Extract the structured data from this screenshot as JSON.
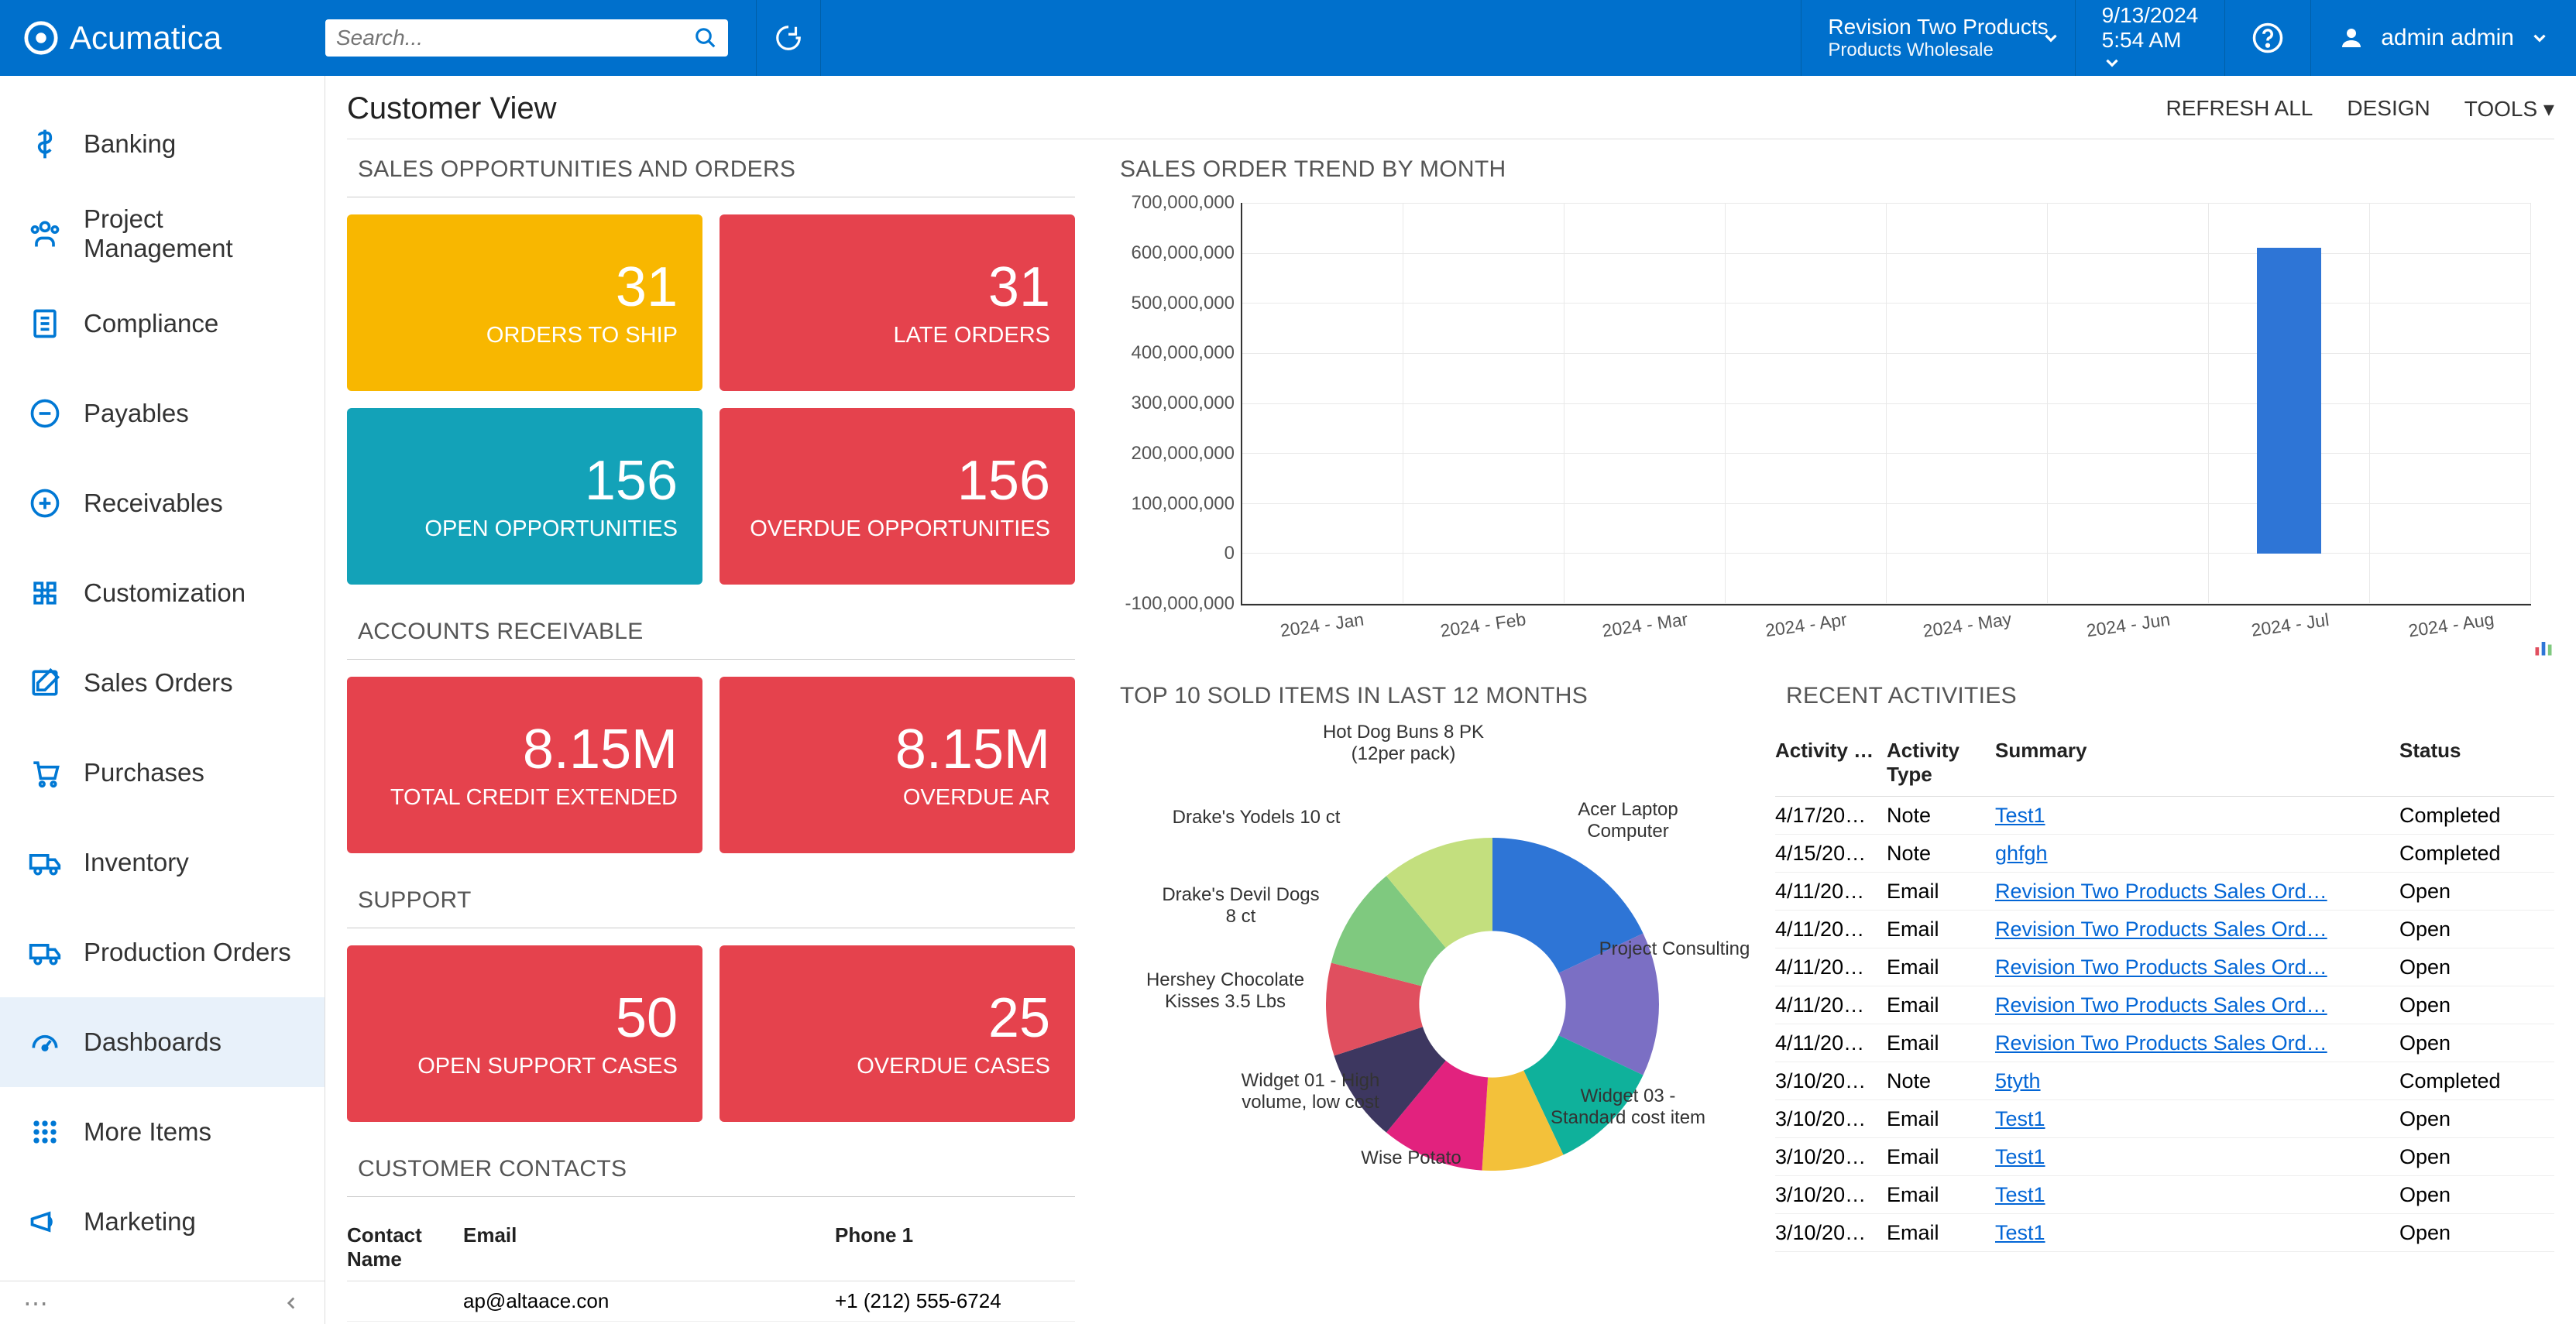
{
  "topbar": {
    "logo_text": "Acumatica",
    "search_placeholder": "Search...",
    "company_line1": "Revision Two Products",
    "company_line2": "Products Wholesale",
    "date_line1": "9/13/2024",
    "date_line2": "5:54 AM",
    "user": "admin admin"
  },
  "sidebar": {
    "items": [
      {
        "label": "Banking",
        "icon": "dollar"
      },
      {
        "label": "Project Management",
        "icon": "person"
      },
      {
        "label": "Compliance",
        "icon": "document"
      },
      {
        "label": "Payables",
        "icon": "minus-circle"
      },
      {
        "label": "Receivables",
        "icon": "plus-circle"
      },
      {
        "label": "Customization",
        "icon": "puzzle"
      },
      {
        "label": "Sales Orders",
        "icon": "edit"
      },
      {
        "label": "Purchases",
        "icon": "cart"
      },
      {
        "label": "Inventory",
        "icon": "truck"
      },
      {
        "label": "Production Orders",
        "icon": "truck"
      },
      {
        "label": "Dashboards",
        "icon": "gauge",
        "active": true
      },
      {
        "label": "More Items",
        "icon": "grid"
      },
      {
        "label": "Marketing",
        "icon": "megaphone"
      }
    ]
  },
  "page": {
    "title": "Customer View",
    "actions": {
      "refresh": "REFRESH ALL",
      "design": "DESIGN",
      "tools": "TOOLS"
    }
  },
  "sections": {
    "sales_opp": "SALES OPPORTUNITIES AND ORDERS",
    "trend": "SALES ORDER TREND BY MONTH",
    "ar": "ACCOUNTS RECEIVABLE",
    "support": "SUPPORT",
    "contacts": "CUSTOMER CONTACTS",
    "top10": "TOP 10 SOLD ITEMS IN LAST 12 MONTHS",
    "activities": "RECENT ACTIVITIES"
  },
  "kpi": {
    "orders_to_ship": {
      "val": "31",
      "lab": "ORDERS TO SHIP"
    },
    "late_orders": {
      "val": "31",
      "lab": "LATE ORDERS"
    },
    "open_opp": {
      "val": "156",
      "lab": "OPEN OPPORTUNITIES"
    },
    "overdue_opp": {
      "val": "156",
      "lab": "OVERDUE OPPORTUNITIES"
    },
    "credit_extended": {
      "val": "8.15M",
      "lab": "TOTAL CREDIT EXTENDED"
    },
    "overdue_ar": {
      "val": "8.15M",
      "lab": "OVERDUE AR"
    },
    "open_support": {
      "val": "50",
      "lab": "OPEN SUPPORT CASES"
    },
    "overdue_cases": {
      "val": "25",
      "lab": "OVERDUE CASES"
    }
  },
  "chart_data": {
    "type": "bar",
    "title": "SALES ORDER TREND BY MONTH",
    "xlabel": "",
    "ylabel": "",
    "ylim": [
      -100000000,
      700000000
    ],
    "y_ticks": [
      "700,000,000",
      "600,000,000",
      "500,000,000",
      "400,000,000",
      "300,000,000",
      "200,000,000",
      "100,000,000",
      "0",
      "-100,000,000"
    ],
    "categories": [
      "2024 - Jan",
      "2024 - Feb",
      "2024 - Mar",
      "2024 - Apr",
      "2024 - May",
      "2024 - Jun",
      "2024 - Jul",
      "2024 - Aug"
    ],
    "values": [
      0,
      0,
      0,
      0,
      0,
      0,
      610000000,
      0
    ]
  },
  "contacts": {
    "headers": {
      "name": "Contact Name",
      "email": "Email",
      "phone": "Phone 1"
    },
    "rows": [
      {
        "name": "",
        "email": "ap@altaace.con",
        "phone": "+1 (212) 555-6724"
      }
    ]
  },
  "pie": {
    "labels": [
      "Hot Dog Buns 8 PK (12per pack)",
      "Acer Laptop Computer",
      "Project Consulting",
      "Widget 03 - Standard cost item",
      "Wise Potato",
      "Widget 01 - High volume, low cost",
      "Hershey Chocolate Kisses 3.5 Lbs",
      "Drake's Devil Dogs 8 ct",
      "Drake's Yodels 10 ct"
    ],
    "slices": [
      {
        "label": "Acer Laptop Computer",
        "pct": 18,
        "color": "#2e75d6"
      },
      {
        "label": "Project Consulting",
        "pct": 14,
        "color": "#7b6fc4"
      },
      {
        "label": "Widget 03 - Standard cost item",
        "pct": 11,
        "color": "#0fb19b"
      },
      {
        "label": "Wise Potato",
        "pct": 8,
        "color": "#f3c13a"
      },
      {
        "label": "Widget 01 - High volume, low cost",
        "pct": 10,
        "color": "#e2227e"
      },
      {
        "label": "Hershey Chocolate Kisses 3.5 Lbs",
        "pct": 9,
        "color": "#3d3760"
      },
      {
        "label": "Drake's Devil Dogs 8 ct",
        "pct": 9,
        "color": "#e04f5f"
      },
      {
        "label": "Drake's Yodels 10 ct",
        "pct": 10,
        "color": "#7fc97f"
      },
      {
        "label": "Hot Dog Buns 8 PK (12per pack)",
        "pct": 11,
        "color": "#c3df7e"
      }
    ]
  },
  "activities": {
    "headers": {
      "date": "Activity Date",
      "type": "Activity Type",
      "summary": "Summary",
      "status": "Status"
    },
    "rows": [
      {
        "date": "4/17/20…",
        "type": "Note",
        "summary": "Test1",
        "status": "Completed"
      },
      {
        "date": "4/15/20…",
        "type": "Note",
        "summary": "ghfgh",
        "status": "Completed"
      },
      {
        "date": "4/11/20…",
        "type": "Email",
        "summary": "Revision Two Products Sales Ord…",
        "status": "Open"
      },
      {
        "date": "4/11/20…",
        "type": "Email",
        "summary": "Revision Two Products Sales Ord…",
        "status": "Open"
      },
      {
        "date": "4/11/20…",
        "type": "Email",
        "summary": "Revision Two Products Sales Ord…",
        "status": "Open"
      },
      {
        "date": "4/11/20…",
        "type": "Email",
        "summary": "Revision Two Products Sales Ord…",
        "status": "Open"
      },
      {
        "date": "4/11/20…",
        "type": "Email",
        "summary": "Revision Two Products Sales Ord…",
        "status": "Open"
      },
      {
        "date": "3/10/20…",
        "type": "Note",
        "summary": "5tyth",
        "status": "Completed"
      },
      {
        "date": "3/10/20…",
        "type": "Email",
        "summary": "Test1",
        "status": "Open"
      },
      {
        "date": "3/10/20…",
        "type": "Email",
        "summary": "Test1",
        "status": "Open"
      },
      {
        "date": "3/10/20…",
        "type": "Email",
        "summary": "Test1",
        "status": "Open"
      },
      {
        "date": "3/10/20…",
        "type": "Email",
        "summary": "Test1",
        "status": "Open"
      }
    ]
  }
}
